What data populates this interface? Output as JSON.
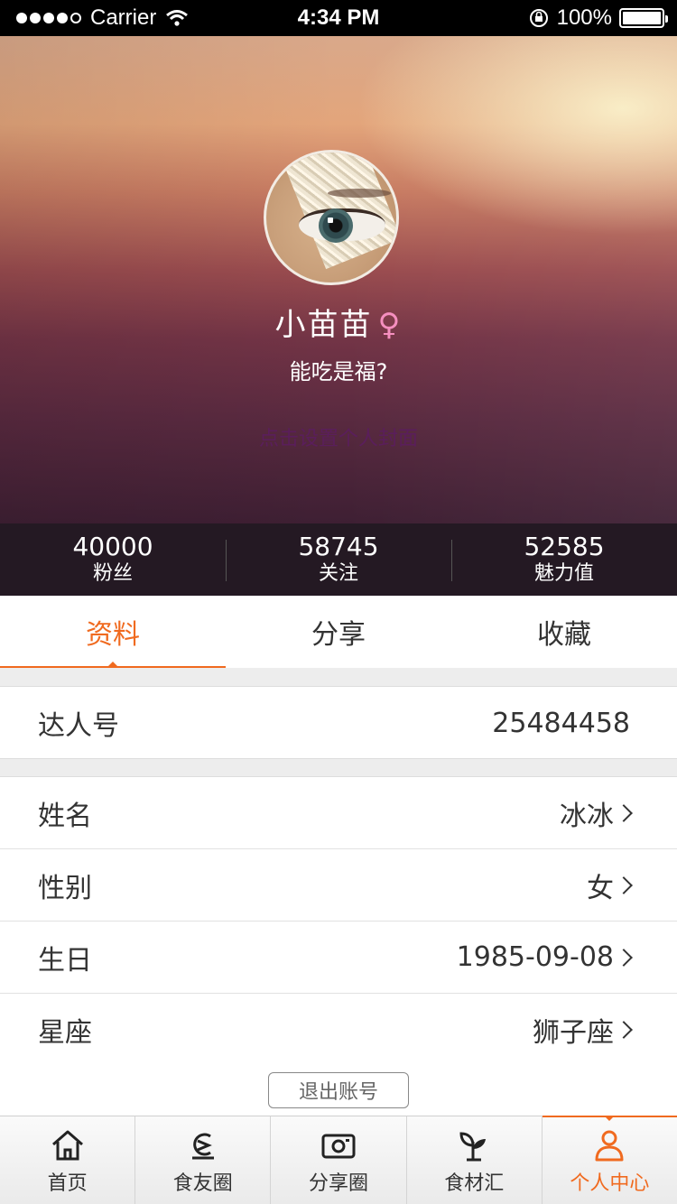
{
  "status_bar": {
    "carrier": "Carrier",
    "time": "4:34 PM",
    "battery": "100%"
  },
  "profile": {
    "name": "小苗苗",
    "gender_symbol": "♀",
    "motto": "能吃是福?",
    "cover_hint": "点击设置个人封面"
  },
  "stats": [
    {
      "value": "40000",
      "label": "粉丝"
    },
    {
      "value": "58745",
      "label": "关注"
    },
    {
      "value": "52585",
      "label": "魅力值"
    }
  ],
  "tabs": [
    {
      "label": "资料",
      "active": true
    },
    {
      "label": "分享",
      "active": false
    },
    {
      "label": "收藏",
      "active": false
    }
  ],
  "info": {
    "id_label": "达人号",
    "id_value": "25484458",
    "rows": [
      {
        "label": "姓名",
        "value": "冰冰"
      },
      {
        "label": "性别",
        "value": "女"
      },
      {
        "label": "生日",
        "value": "1985-09-08"
      },
      {
        "label": "星座",
        "value": "狮子座"
      }
    ]
  },
  "logout_label": "退出账号",
  "bottom_nav": [
    {
      "label": "首页",
      "icon": "home-icon",
      "active": false
    },
    {
      "label": "食友圈",
      "icon": "food-friends-icon",
      "active": false
    },
    {
      "label": "分享圈",
      "icon": "camera-icon",
      "active": false
    },
    {
      "label": "食材汇",
      "icon": "sprout-icon",
      "active": false
    },
    {
      "label": "个人中心",
      "icon": "person-icon",
      "active": true
    }
  ],
  "colors": {
    "accent": "#f06a1f",
    "gender": "#f58fbf",
    "cover_hint": "#5a1e5b"
  }
}
